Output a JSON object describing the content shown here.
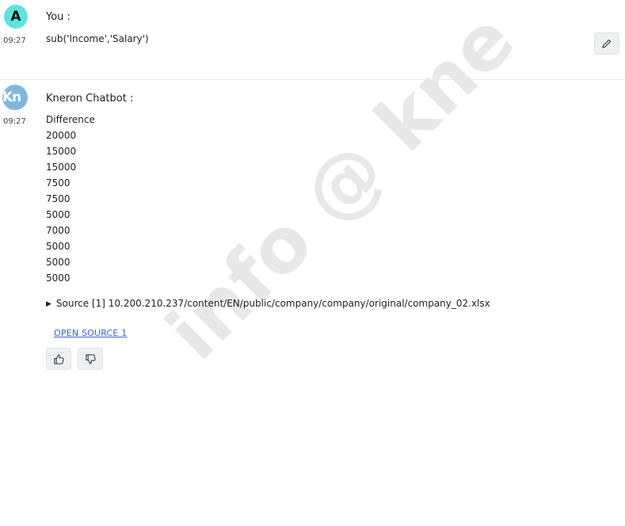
{
  "user_message": {
    "avatar_letter": "A",
    "sender": "You :",
    "time": "09:27",
    "text": "sub('Income','Salary')"
  },
  "bot_message": {
    "avatar_text": "Kn",
    "sender": "Kneron Chatbot :",
    "time": "09:27",
    "lines": [
      "Difference",
      "20000",
      "15000",
      "15000",
      "7500",
      "7500",
      "5000",
      "7000",
      "5000",
      "5000",
      "5000"
    ],
    "source_label": "Source [1] 10.200.210.237/content/EN/public/company/company/original/company_02.xlsx",
    "open_source_label": "OPEN SOURCE 1"
  },
  "watermark": "info @ kne",
  "colors": {
    "user_avatar_bg": "#5fe3dc",
    "bot_avatar_bg": "#7fb7e0",
    "link": "#3a63d8"
  },
  "icons": {
    "edit": "pencil-icon",
    "like": "thumbs-up-icon",
    "dislike": "thumbs-down-icon",
    "expand": "triangle-right-icon"
  }
}
